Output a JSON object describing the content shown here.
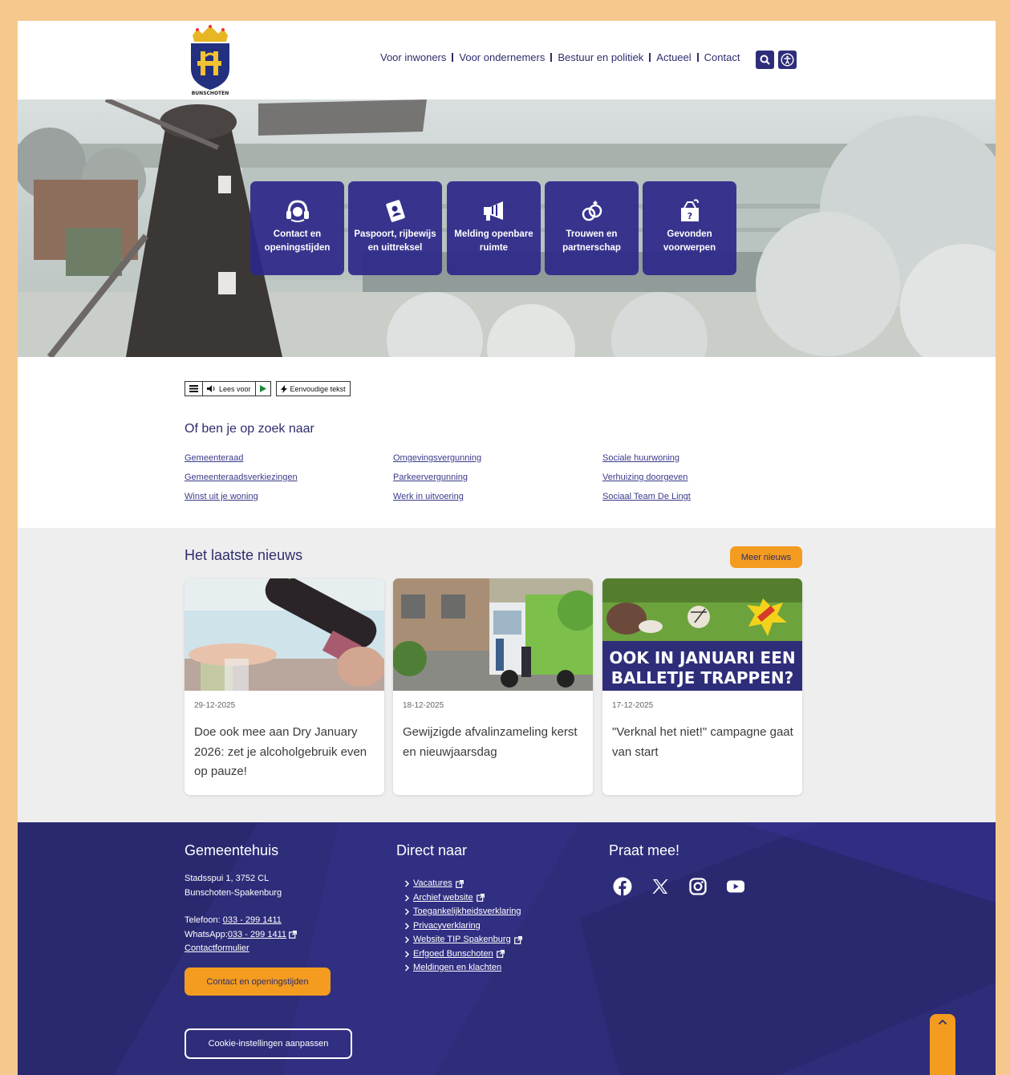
{
  "colors": {
    "brand": "#2e2d7a",
    "accent": "#f39c1f",
    "frame": "#f5c98e"
  },
  "header": {
    "logo_text": "BUNSCHOTEN",
    "nav": [
      "Voor inwoners",
      "Voor ondernemers",
      "Bestuur en politiek",
      "Actueel",
      "Contact"
    ],
    "search_icon": "search-icon",
    "accessibility_icon": "accessibility-icon"
  },
  "hero": {
    "tiles": [
      {
        "label_1": "Contact en",
        "label_2": "openingstijden",
        "icon": "headset-icon"
      },
      {
        "label_1": "Paspoort, rijbewijs",
        "label_2": "en uittreksel",
        "icon": "id-card-icon"
      },
      {
        "label_1": "Melding openbare",
        "label_2": "ruimte",
        "icon": "megaphone-icon"
      },
      {
        "label_1": "Trouwen en",
        "label_2": "partnerschap",
        "icon": "rings-icon"
      },
      {
        "label_1": "Gevonden",
        "label_2": "voorwerpen",
        "icon": "lost-found-icon"
      }
    ]
  },
  "readbar": {
    "read_label": "Lees voor",
    "simple_label": "Eenvoudige tekst"
  },
  "suggest": {
    "title": "Of ben je op zoek naar",
    "col1": [
      "Gemeenteraad",
      "Gemeenteraadsverkiezingen",
      "Winst uit je woning"
    ],
    "col2": [
      "Omgevingsvergunning",
      "Parkeervergunning",
      "Werk in uitvoering"
    ],
    "col3": [
      "Sociale huurwoning",
      "Verhuizing doorgeven",
      "Sociaal Team De Lingt"
    ]
  },
  "news": {
    "title": "Het laatste nieuws",
    "more_label": "Meer nieuws",
    "cards": [
      {
        "date": "29-12-2025",
        "title": "Doe ook mee aan Dry January 2026: zet je alcoholgebruik even op pauze!"
      },
      {
        "date": "18-12-2025",
        "title": "Gewijzigde afvalinzameling kerst en nieuwjaarsdag"
      },
      {
        "date": "17-12-2025",
        "title": "\"Verknal het niet!\" campagne gaat van start",
        "image_text_1": "OOK IN JANUARI EEN",
        "image_text_2": "BALLETJE TRAPPEN?"
      }
    ]
  },
  "footer": {
    "col1_title": "Gemeentehuis",
    "address_1": "Stadsspui 1, 3752 CL",
    "address_2": "Bunschoten-Spakenburg",
    "phone_label": "Telefoon: ",
    "phone": "033 - 299 1411",
    "whatsapp_label": "WhatsApp: ",
    "whatsapp": "033 - 299 1411",
    "contact_form": "Contactformulier",
    "contact_button": "Contact en openingstijden",
    "cookie_button": "Cookie-instellingen aanpassen",
    "col2_title": "Direct naar",
    "links": [
      {
        "label": "Vacatures",
        "external": true
      },
      {
        "label": "Archief website",
        "external": true
      },
      {
        "label": "Toegankelijkheidsverklaring",
        "external": false
      },
      {
        "label": "Privacyverklaring",
        "external": false
      },
      {
        "label": "Website TIP Spakenburg",
        "external": true
      },
      {
        "label": "Erfgoed Bunschoten",
        "external": true
      },
      {
        "label": "Meldingen en klachten",
        "external": false
      }
    ],
    "col3_title": "Praat mee!",
    "social": [
      "facebook-icon",
      "x-icon",
      "instagram-icon",
      "youtube-icon"
    ]
  }
}
